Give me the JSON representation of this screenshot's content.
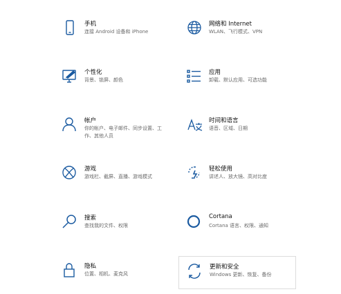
{
  "colors": {
    "accent": "#1a5aa0",
    "title": "#111111",
    "desc": "#6a6a6a"
  },
  "tiles": [
    {
      "id": "phone",
      "icon": "phone-icon",
      "title": "手机",
      "desc": "连接 Android 设备和 iPhone"
    },
    {
      "id": "network",
      "icon": "globe-icon",
      "title": "网络和 Internet",
      "desc": "WLAN、飞行模式、VPN"
    },
    {
      "id": "personalization",
      "icon": "paint-monitor-icon",
      "title": "个性化",
      "desc": "背景、锁屏、颜色"
    },
    {
      "id": "apps",
      "icon": "apps-list-icon",
      "title": "应用",
      "desc": "卸载、默认应用、可选功能"
    },
    {
      "id": "accounts",
      "icon": "person-icon",
      "title": "帐户",
      "desc": "你的帐户、电子邮件、同步设置、工作、其他人员"
    },
    {
      "id": "time-language",
      "icon": "time-language-icon",
      "title": "时间和语言",
      "desc": "语音、区域、日期"
    },
    {
      "id": "gaming",
      "icon": "xbox-icon",
      "title": "游戏",
      "desc": "游戏栏、截屏、直播、游戏模式"
    },
    {
      "id": "ease-of-access",
      "icon": "ease-of-access-icon",
      "title": "轻松使用",
      "desc": "讲述人、放大镜、高对比度"
    },
    {
      "id": "search",
      "icon": "search-icon",
      "title": "搜索",
      "desc": "查找我的文件、权限"
    },
    {
      "id": "cortana",
      "icon": "cortana-ring-icon",
      "title": "Cortana",
      "desc": "Cortana 语言、权限、通知"
    },
    {
      "id": "privacy",
      "icon": "lock-icon",
      "title": "隐私",
      "desc": "位置、相机、麦克风"
    },
    {
      "id": "update-security",
      "icon": "sync-arrows-icon",
      "title": "更新和安全",
      "desc": "Windows 更新、恢复、备份"
    }
  ]
}
